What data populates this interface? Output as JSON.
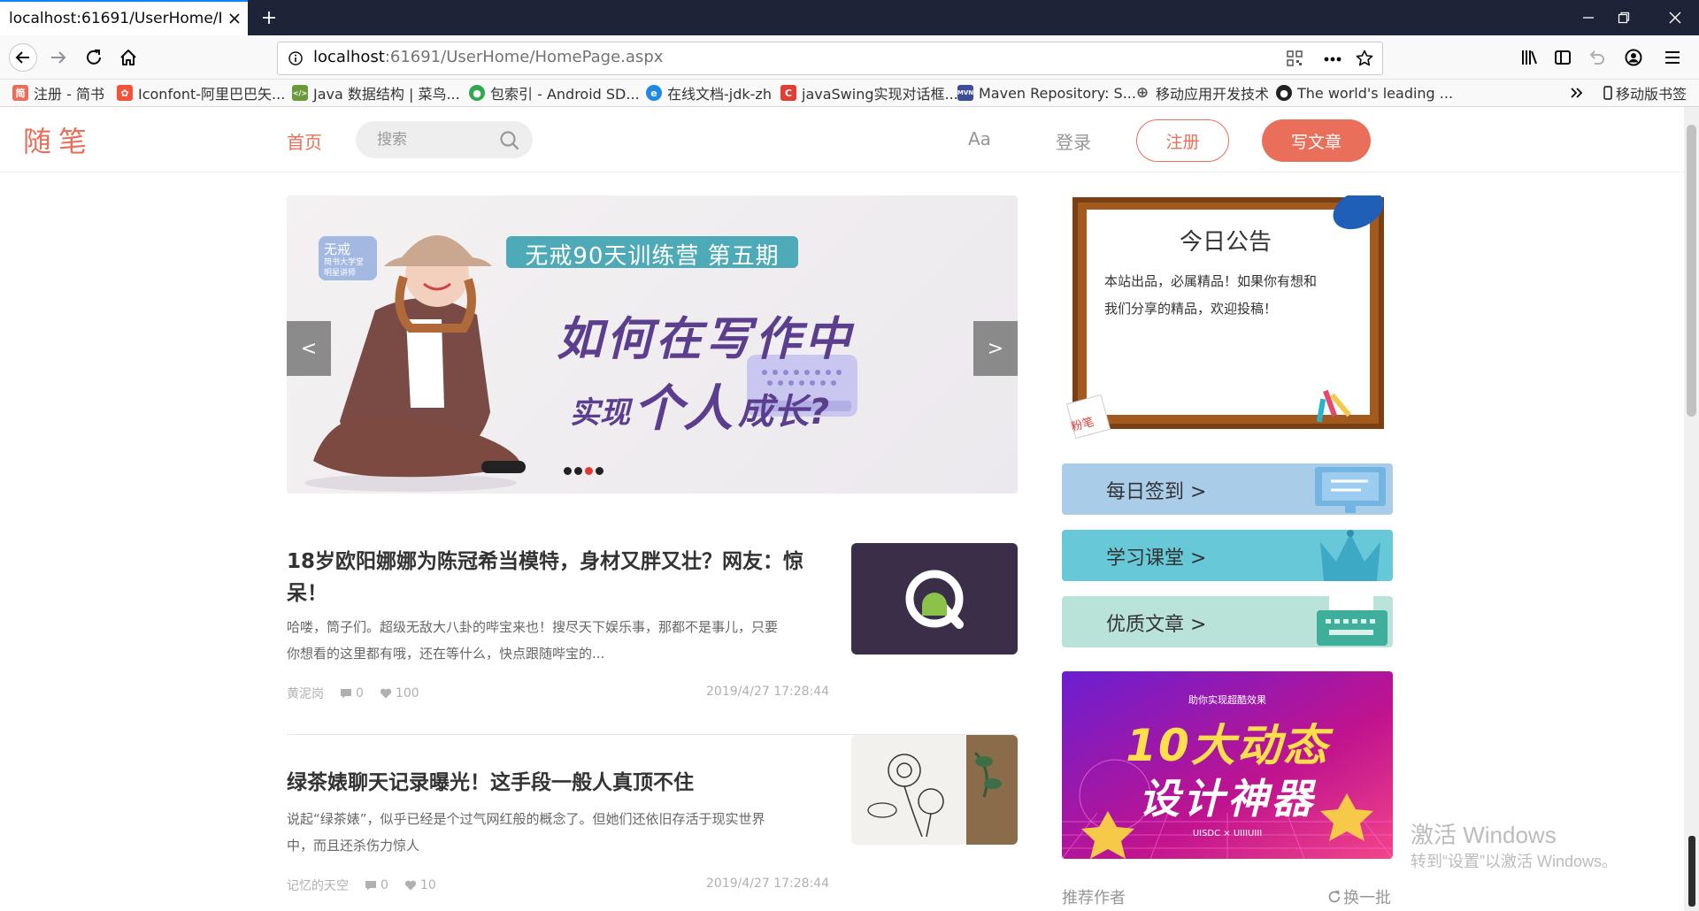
{
  "browser": {
    "tab_title": "localhost:61691/UserHome/Hom",
    "url_host": "localhost",
    "url_rest": ":61691/UserHome/HomePage.aspx",
    "bookmarks": [
      {
        "label": "注册 - 简书",
        "icon": "jianshu-icon",
        "color": "#ea6f5a",
        "glyph": "简"
      },
      {
        "label": "Iconfont-阿里巴巴矢...",
        "icon": "iconfont-icon",
        "color": "#f5523a",
        "glyph": "✿"
      },
      {
        "label": "Java 数据结构 | 菜鸟...",
        "icon": "runoob-icon",
        "color": "#6b9a3b",
        "glyph": "</>"
      },
      {
        "label": "包索引 - Android SD...",
        "icon": "android-icon",
        "color": "#2fa84f",
        "glyph": "●"
      },
      {
        "label": "在线文档-jdk-zh",
        "icon": "edge-icon",
        "color": "#1e88e5",
        "glyph": "e"
      },
      {
        "label": "javaSwing实现对话框...",
        "icon": "csdn-icon",
        "color": "#e33e33",
        "glyph": "C"
      },
      {
        "label": "Maven Repository: S...",
        "icon": "maven-icon",
        "color": "#3d4e99",
        "glyph": "MVN"
      },
      {
        "label": "移动应用开发技术",
        "icon": "globe-icon",
        "color": "#555555",
        "glyph": "⊕"
      },
      {
        "label": "The world's leading ...",
        "icon": "github-icon",
        "color": "#222222",
        "glyph": "●"
      }
    ],
    "mobile_bookmarks": "移动版书签"
  },
  "header": {
    "logo": "随笔",
    "nav_home": "首页",
    "search_placeholder": "搜索",
    "aa": "Aa",
    "login": "登录",
    "register": "注册",
    "write": "写文章"
  },
  "banner": {
    "tag_name": "无戒",
    "tag_sub1": "简书大学堂",
    "tag_sub2": "明星讲师",
    "headline": "无戒90天训练营 第五期",
    "line1": "如何在写作中",
    "line2a": "实现",
    "line2b": "个人",
    "line2c": "成长?",
    "prev": "<",
    "next": ">",
    "active_slide": 3,
    "slide_count": 4
  },
  "articles": [
    {
      "title": "18岁欧阳娜娜为陈冠希当模特，身材又胖又壮？网友：惊呆！",
      "title_line1": "18岁欧阳娜娜为陈冠希当模特，身材又胖又壮？网友：惊",
      "title_line2": "呆！",
      "desc_line1": "哈喽，筒子们。超级无敌大八卦的哔宝来也！搜尽天下娱乐事，那都不是事儿，只要",
      "desc_line2": "你想看的这里都有哦，还在等什么，快点跟随哔宝的...",
      "author": "黄泥岗",
      "comments": "0",
      "likes": "100",
      "time": "2019/4/27 17:28:44"
    },
    {
      "title": "绿茶婊聊天记录曝光！这手段一般人真顶不住",
      "desc_line1": "说起“绿茶婊”，似乎已经是个过气网红般的概念了。但她们还依旧存活于现实世界",
      "desc_line2": "中，而且还杀伤力惊人",
      "author": "记忆的天空",
      "comments": "0",
      "likes": "10",
      "time": "2019/4/27 17:28:44"
    }
  ],
  "sidebar": {
    "notice_title": "今日公告",
    "notice_line1": "本站出品，必属精品！如果你有想和",
    "notice_line2": "我们分享的精品，欢迎投稿！",
    "chalk_label": "粉笔",
    "buttons": [
      {
        "label": "每日签到 >",
        "color": "#a9cde8"
      },
      {
        "label": "学习课堂 >",
        "color": "#67c8d8"
      },
      {
        "label": "优质文章 >",
        "color": "#b9e2d9"
      }
    ],
    "promo_top": "助你实现超酷效果",
    "promo_line1": "10大动态",
    "promo_line2": "设计神器",
    "promo_footer": "UISDC × UIIIUIII",
    "recommended_authors": "推荐作者",
    "swap": "换一批"
  },
  "watermark": {
    "line1": "激活 Windows",
    "line2": "转到“设置”以激活 Windows。"
  }
}
